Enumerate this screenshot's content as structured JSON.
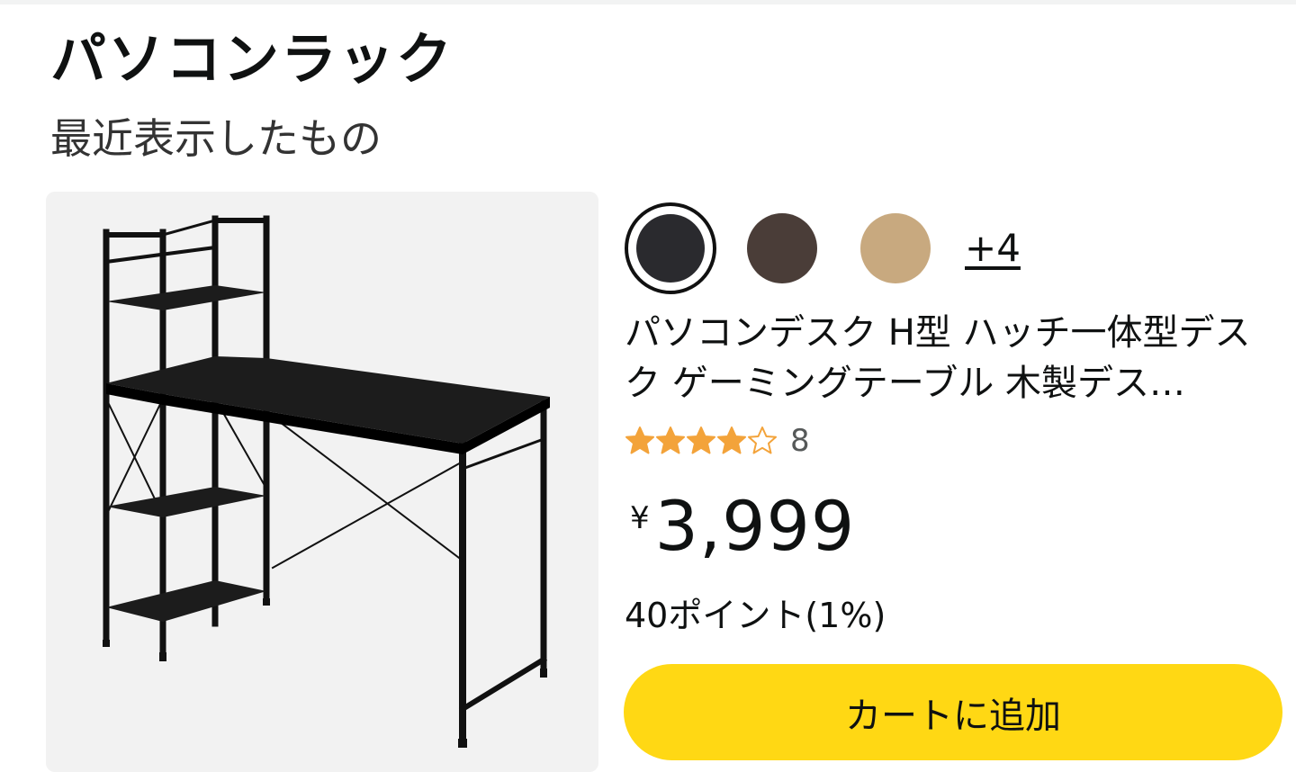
{
  "header": {
    "title": "パソコンラック",
    "subtitle": "最近表示したもの"
  },
  "product": {
    "image_alt": "product-desk-image",
    "color_swatches": [
      {
        "name": "black",
        "color": "#2a2a2e",
        "selected": true
      },
      {
        "name": "brown",
        "color": "#4a3d38",
        "selected": false
      },
      {
        "name": "natural",
        "color": "#c8a97f",
        "selected": false
      }
    ],
    "more_colors_label": "+4",
    "title": "パソコンデスク H型 ハッチ一体型デスク ゲーミングテーブル 木製デス…",
    "rating": {
      "stars": 4,
      "max": 5,
      "count": "8",
      "star_color": "#f3a33a"
    },
    "price": {
      "currency": "¥",
      "amount": "3,999"
    },
    "points": "40ポイント(1%)",
    "add_to_cart_label": "カートに追加",
    "button_color": "#ffd814"
  }
}
